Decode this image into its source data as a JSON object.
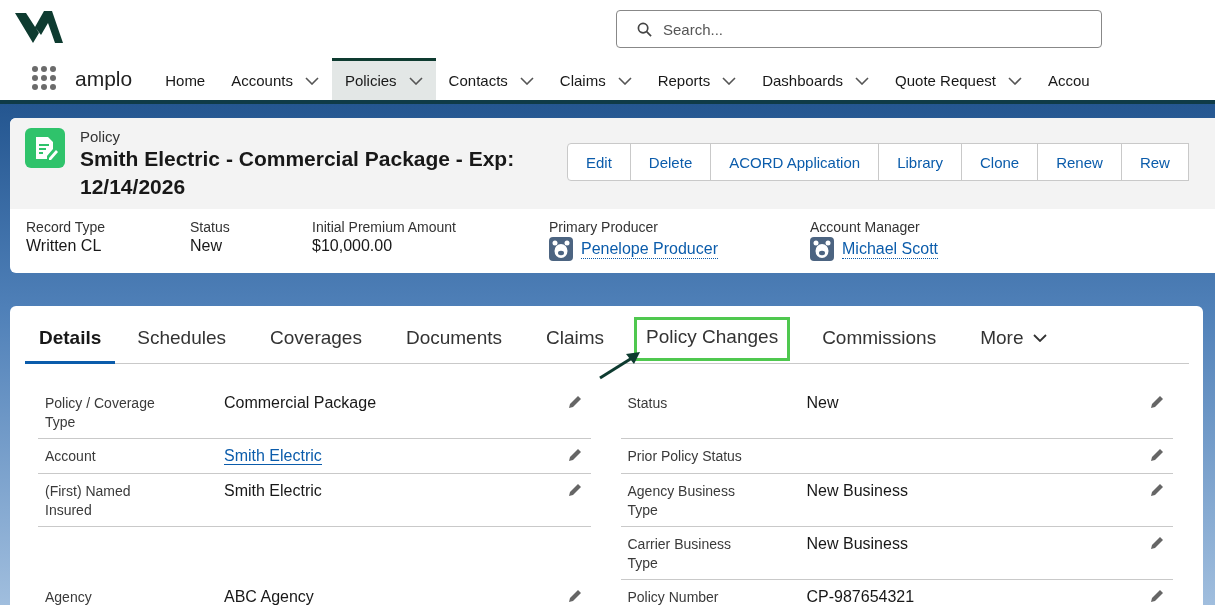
{
  "header": {
    "app_name": "amplo",
    "search": {
      "placeholder": "Search..."
    }
  },
  "nav": [
    {
      "label": "Home",
      "dropdown": false,
      "selected": false
    },
    {
      "label": "Accounts",
      "dropdown": true,
      "selected": false
    },
    {
      "label": "Policies",
      "dropdown": true,
      "selected": true
    },
    {
      "label": "Contacts",
      "dropdown": true,
      "selected": false
    },
    {
      "label": "Claims",
      "dropdown": true,
      "selected": false
    },
    {
      "label": "Reports",
      "dropdown": true,
      "selected": false
    },
    {
      "label": "Dashboards",
      "dropdown": true,
      "selected": false
    },
    {
      "label": "Quote Request",
      "dropdown": true,
      "selected": false
    },
    {
      "label": "Accou",
      "dropdown": false,
      "selected": false
    }
  ],
  "record": {
    "object_type": "Policy",
    "title": "Smith Electric - Commercial Package - Exp: 12/14/2026",
    "actions": [
      "Edit",
      "Delete",
      "ACORD Application",
      "Library",
      "Clone",
      "Renew",
      "Rew"
    ],
    "highlights": [
      {
        "label": "Record Type",
        "value": "Written CL",
        "kind": "text"
      },
      {
        "label": "Status",
        "value": "New",
        "kind": "text"
      },
      {
        "label": "Initial Premium Amount",
        "value": "$10,000.00",
        "kind": "text"
      },
      {
        "label": "Primary Producer",
        "value": "Penelope Producer",
        "kind": "user"
      },
      {
        "label": "Account Manager",
        "value": "Michael Scott",
        "kind": "user"
      }
    ]
  },
  "tabs": [
    {
      "label": "Details",
      "selected": true,
      "highlighted": false,
      "dropdown": false
    },
    {
      "label": "Schedules",
      "selected": false,
      "highlighted": false,
      "dropdown": false
    },
    {
      "label": "Coverages",
      "selected": false,
      "highlighted": false,
      "dropdown": false
    },
    {
      "label": "Documents",
      "selected": false,
      "highlighted": false,
      "dropdown": false
    },
    {
      "label": "Claims",
      "selected": false,
      "highlighted": false,
      "dropdown": false
    },
    {
      "label": "Policy Changes",
      "selected": false,
      "highlighted": true,
      "dropdown": false
    },
    {
      "label": "Commissions",
      "selected": false,
      "highlighted": false,
      "dropdown": false
    },
    {
      "label": "More",
      "selected": false,
      "highlighted": false,
      "dropdown": true
    }
  ],
  "fields": [
    {
      "left": {
        "label": "Policy / Coverage Type",
        "value": "Commercial Package",
        "kind": "text"
      },
      "right": {
        "label": "Status",
        "value": "New",
        "kind": "text"
      }
    },
    {
      "left": {
        "label": "Account",
        "value": "Smith Electric",
        "kind": "link"
      },
      "right": {
        "label": "Prior Policy Status",
        "kind": "text"
      }
    },
    {
      "left": {
        "label": "(First) Named Insured",
        "value": "Smith Electric",
        "kind": "text"
      },
      "right": {
        "label": "Agency Business Type",
        "value": "New Business",
        "kind": "text"
      }
    },
    {
      "right": {
        "label": "Carrier Business Type",
        "value": "New Business",
        "kind": "text"
      }
    },
    {
      "left": {
        "label": "Agency",
        "value": "ABC Agency",
        "kind": "text"
      },
      "right": {
        "label": "Policy Number",
        "value": "CP-987654321",
        "kind": "text"
      }
    }
  ]
}
